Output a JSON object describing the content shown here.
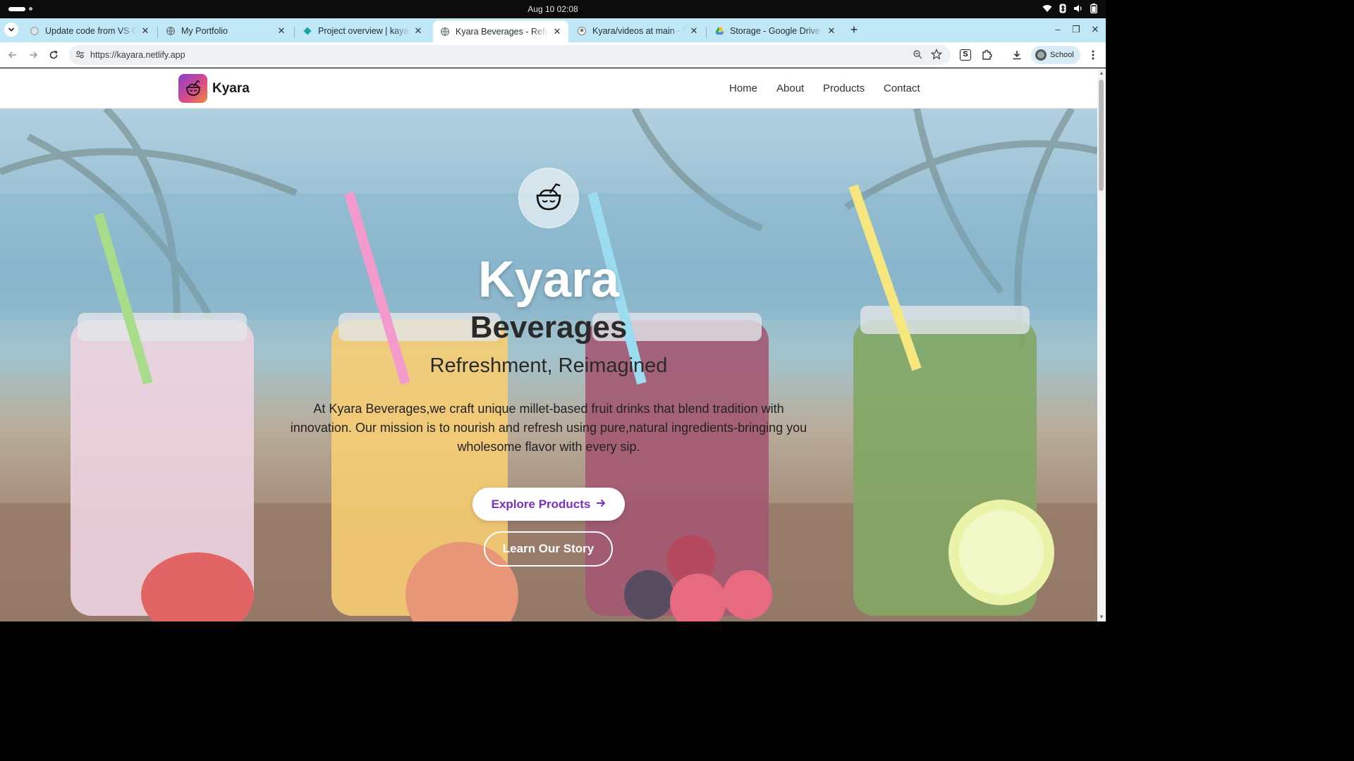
{
  "os": {
    "clock": "Aug 10  02:08",
    "tray_icons": [
      "wifi-icon",
      "bluetooth-icon",
      "volume-icon",
      "battery-icon"
    ]
  },
  "browser": {
    "tabs": [
      {
        "title": "Update code from VS Co",
        "favicon": "globe-icon",
        "active": false
      },
      {
        "title": "My Portfolio",
        "favicon": "globe-icon",
        "active": false
      },
      {
        "title": "Project overview | kayara",
        "favicon": "netlify-icon",
        "active": false
      },
      {
        "title": "Kyara Beverages - Refres",
        "favicon": "globe-icon",
        "active": true
      },
      {
        "title": "Kyara/videos at main · Vij",
        "favicon": "github-icon",
        "active": false
      },
      {
        "title": "Storage - Google Drive",
        "favicon": "google-drive-icon",
        "active": false
      }
    ],
    "url": "https://kayara.netlify.app",
    "profile_label": "School"
  },
  "site": {
    "brand": "Kyara",
    "nav": [
      "Home",
      "About",
      "Products",
      "Contact"
    ],
    "hero": {
      "title": "Kyara",
      "subtitle": "Beverages",
      "tagline": "Refreshment, Reimagined",
      "description": "At Kyara Beverages,we craft unique millet-based fruit drinks that blend tradition with innovation. Our mission is to nourish and refresh using pure,natural ingredients-bringing you wholesome flavor with every sip.",
      "primary_cta": "Explore Products",
      "secondary_cta": "Learn Our Story"
    }
  },
  "colors": {
    "tab_strip": "#bfe7f5",
    "accent_purple": "#7a2fc9",
    "logo_gradient": [
      "#8a3fd1",
      "#d74a8a",
      "#f28a35"
    ]
  }
}
